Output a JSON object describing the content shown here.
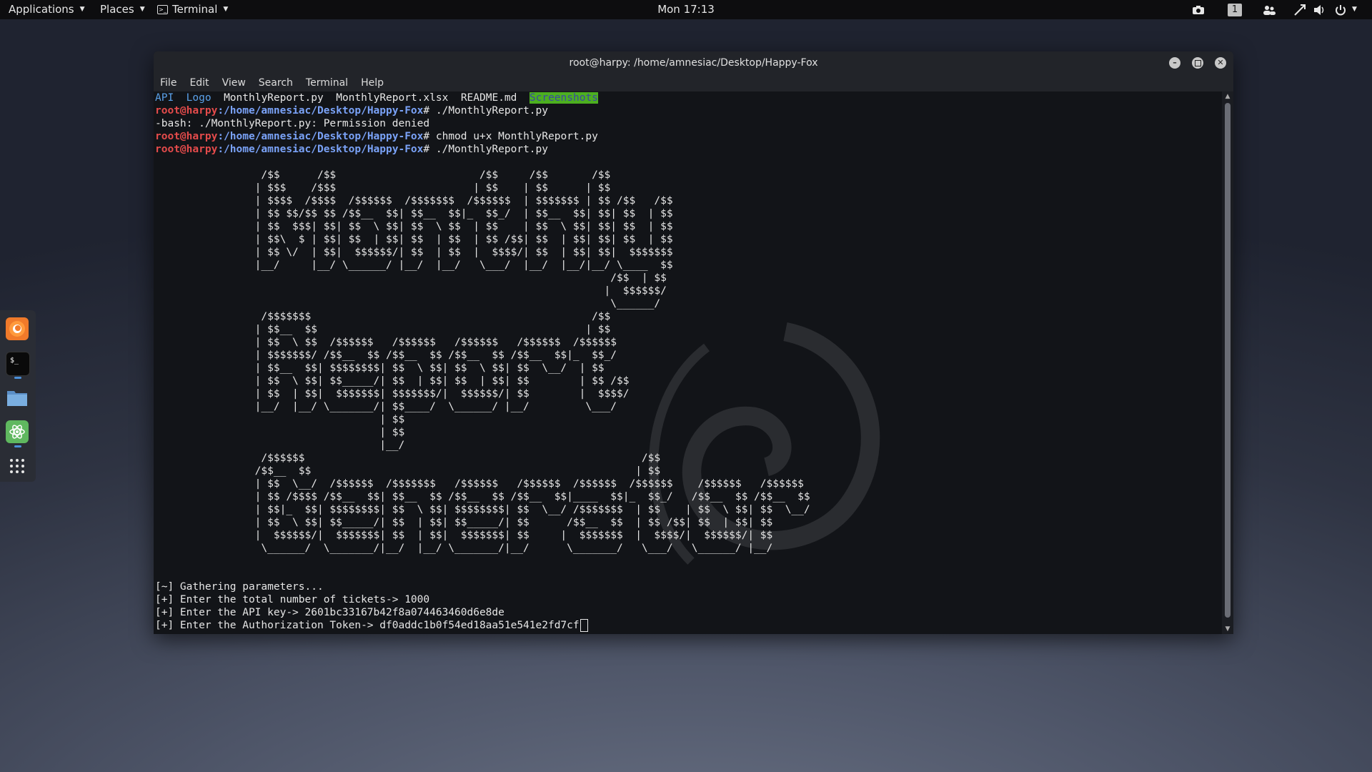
{
  "topbar": {
    "applications": "Applications",
    "places": "Places",
    "terminal": "Terminal",
    "clock": "Mon 17:13",
    "workspace": "1"
  },
  "dock": {
    "items": [
      "firefox",
      "terminal",
      "files",
      "atom",
      "app-grid"
    ]
  },
  "window": {
    "title": "root@harpy: /home/amnesiac/Desktop/Happy-Fox",
    "menu": [
      "File",
      "Edit",
      "View",
      "Search",
      "Terminal",
      "Help"
    ]
  },
  "terminal": {
    "ls": {
      "dir1": "API",
      "dir2": "Logo",
      "f1": "MonthlyReport.py",
      "f2": "MonthlyReport.xlsx",
      "f3": "README.md",
      "dir3": "Screenshots"
    },
    "user": "root@harpy",
    "path": ":/home/amnesiac/Desktop/Happy-Fox",
    "cmd1": "# ./MonthlyReport.py",
    "err": "-bash: ./MonthlyReport.py: Permission denied",
    "cmd2": "# chmod u+x MonthlyReport.py",
    "cmd3": "# ./MonthlyReport.py",
    "banner": "                 /$$      /$$                       /$$     /$$       /$$\n                | $$$    /$$$                      | $$    | $$      | $$\n                | $$$$  /$$$$  /$$$$$$  /$$$$$$$  /$$$$$$  | $$$$$$$ | $$ /$$   /$$\n                | $$ $$/$$ $$ /$$__  $$| $$__  $$|_  $$_/  | $$__  $$| $$| $$  | $$\n                | $$  $$$| $$| $$  \\ $$| $$  \\ $$  | $$    | $$  \\ $$| $$| $$  | $$\n                | $$\\  $ | $$| $$  | $$| $$  | $$  | $$ /$$| $$  | $$| $$| $$  | $$\n                | $$ \\/  | $$|  $$$$$$/| $$  | $$  |  $$$$/| $$  | $$| $$|  $$$$$$$\n                |__/     |__/ \\______/ |__/  |__/   \\___/  |__/  |__/|__/ \\____  $$\n                                                                         /$$  | $$\n                                                                        |  $$$$$$/\n                                                                         \\______/\n                 /$$$$$$$                                             /$$\n                | $$__  $$                                           | $$\n                | $$  \\ $$  /$$$$$$   /$$$$$$   /$$$$$$   /$$$$$$  /$$$$$$\n                | $$$$$$$/ /$$__  $$ /$$__  $$ /$$__  $$ /$$__  $$|_  $$_/\n                | $$__  $$| $$$$$$$$| $$  \\ $$| $$  \\ $$| $$  \\__/  | $$\n                | $$  \\ $$| $$_____/| $$  | $$| $$  | $$| $$        | $$ /$$\n                | $$  | $$|  $$$$$$$| $$$$$$$/|  $$$$$$/| $$        |  $$$$/\n                |__/  |__/ \\_______/| $$____/  \\______/ |__/         \\___/\n                                    | $$\n                                    | $$\n                                    |__/\n                 /$$$$$$                                                      /$$\n                /$$__  $$                                                    | $$\n                | $$  \\__/  /$$$$$$  /$$$$$$$   /$$$$$$   /$$$$$$  /$$$$$$  /$$$$$$    /$$$$$$   /$$$$$$\n                | $$ /$$$$ /$$__  $$| $$__  $$ /$$__  $$ /$$__  $$|____  $$|_  $$_/   /$$__  $$ /$$__  $$\n                | $$|_  $$| $$$$$$$$| $$  \\ $$| $$$$$$$$| $$  \\__/ /$$$$$$$  | $$    | $$  \\ $$| $$  \\__/\n                | $$  \\ $$| $$_____/| $$  | $$| $$_____/| $$      /$$__  $$  | $$ /$$| $$  | $$| $$\n                |  $$$$$$/|  $$$$$$$| $$  | $$|  $$$$$$$| $$     |  $$$$$$$  |  $$$$/|  $$$$$$/| $$\n                 \\______/  \\_______/|__/  |__/ \\_______/|__/      \\_______/   \\___/   \\______/ |__/",
    "out1": "[~] Gathering parameters...",
    "out2": "[+] Enter the total number of tickets-> 1000",
    "out3": "[+] Enter the API key-> 2601bc33167b42f8a074463460d6e8de",
    "out4": "[+] Enter the Authorization Token-> df0addc1b0f54ed18aa51e541e2fd7cf"
  }
}
